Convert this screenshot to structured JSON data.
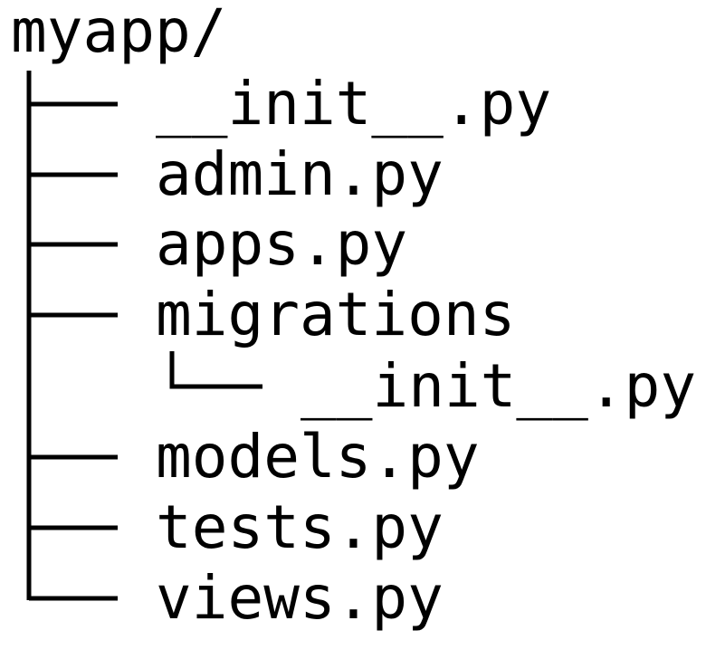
{
  "tree": {
    "root": "myapp/",
    "items": [
      {
        "label": "__init__.py"
      },
      {
        "label": "admin.py"
      },
      {
        "label": "apps.py"
      },
      {
        "label": "migrations",
        "children": [
          {
            "label": "__init__.py"
          }
        ]
      },
      {
        "label": "models.py"
      },
      {
        "label": "tests.py"
      },
      {
        "label": "views.py"
      }
    ]
  }
}
